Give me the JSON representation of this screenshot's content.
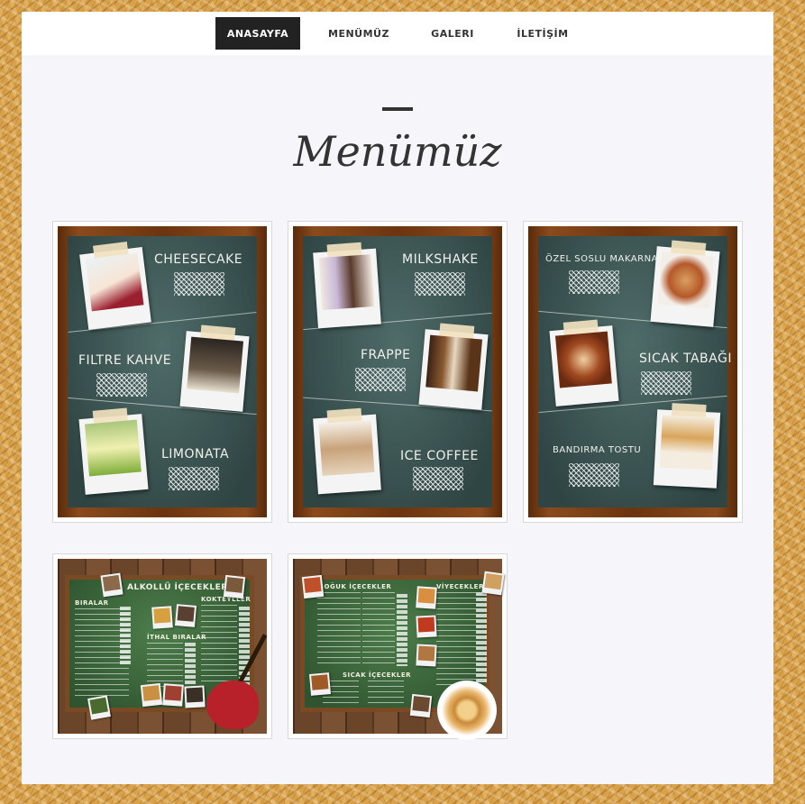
{
  "nav": {
    "items": [
      {
        "label": "ANASAYFA",
        "active": true
      },
      {
        "label": "MENÜMÜZ",
        "active": false
      },
      {
        "label": "GALERI",
        "active": false
      },
      {
        "label": "İLETİŞİM",
        "active": false
      }
    ]
  },
  "page": {
    "title": "Menümüz"
  },
  "menus": [
    {
      "items": [
        "CHEESECAKE",
        "FILTRE KAHVE",
        "LIMONATA"
      ]
    },
    {
      "items": [
        "MILKSHAKE",
        "FRAPPE",
        "ICE COFFEE"
      ]
    },
    {
      "items": [
        "ÖZEL SOSLU MAKARNA",
        "SICAK TABAĞI",
        "BANDIRMA TOSTU"
      ]
    }
  ],
  "wide_menus": [
    {
      "headings": [
        "ALKOLLÜ İÇECEKLER",
        "BIRALAR",
        "İTHAL BIRALAR",
        "KOKTEYLLER"
      ]
    },
    {
      "headings": [
        "SOĞUK İÇECEKLER",
        "VİYECEKLER",
        "SICAK İÇECEKLER"
      ]
    }
  ],
  "colors": {
    "nav_active_bg": "#222222",
    "page_bg": "#f6f5fa",
    "chalkboard": "#3f5a58"
  }
}
